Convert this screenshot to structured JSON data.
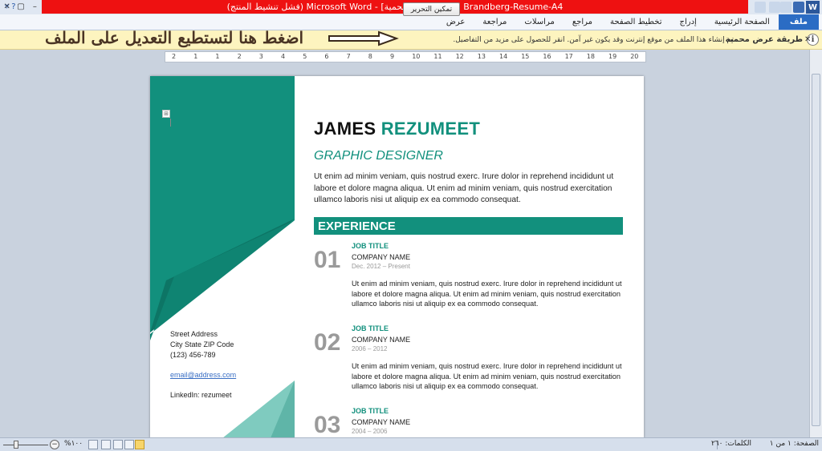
{
  "window": {
    "title": "Brandberg-Resume-A4 [طريقة عرض محمية] - Microsoft Word (فشل تنشيط المنتج)"
  },
  "ribbon": {
    "tabs": [
      "ملف",
      "الصفحة الرئيسية",
      "إدراج",
      "تخطيط الصفحة",
      "مراجع",
      "مراسلات",
      "مراجعة",
      "عرض"
    ]
  },
  "message_bar": {
    "title": "طريقة عرض محمية",
    "message": "تم إنشاء هذا الملف من موقع إنترنت وقد يكون غير آمن. انقر للحصول على مزيد من التفاصيل.",
    "enable_button": "تمكين التحرير",
    "annotation": "اضغط هنا لتستطيع التعديل على الملف"
  },
  "ruler": {
    "numbers": [
      "2",
      "1",
      "1",
      "2",
      "3",
      "4",
      "5",
      "6",
      "7",
      "8",
      "9",
      "10",
      "11",
      "12",
      "13",
      "14",
      "15",
      "16",
      "17",
      "18",
      "19",
      "20"
    ]
  },
  "resume": {
    "first_name": "JAMES",
    "last_name": "REZUMEET",
    "role": "GRAPHIC DESIGNER",
    "summary": "Ut enim ad minim veniam, quis nostrud exerc. Irure dolor in reprehend incididunt ut labore et dolore magna aliqua. Ut enim ad minim veniam, quis nostrud exercitation ullamco laboris nisi ut aliquip ex ea commodo consequat.",
    "contact": {
      "street": "Street Address",
      "city": "City State ZIP Code",
      "phone": "(123) 456-789",
      "email": "email@address.com",
      "linkedin": "LinkedIn:  rezumeet"
    },
    "experience_heading": "EXPERIENCE",
    "jobs": [
      {
        "num": "01",
        "title": "JOB TITLE",
        "company": "COMPANY NAME",
        "dates": "Dec. 2012 – Present",
        "desc": "Ut enim ad minim veniam, quis nostrud exerc. Irure dolor in reprehend incididunt ut labore et dolore magna aliqua. Ut enim ad minim veniam, quis nostrud exercitation ullamco laboris nisi ut aliquip ex ea commodo consequat."
      },
      {
        "num": "02",
        "title": "JOB TITLE",
        "company": "COMPANY NAME",
        "dates": "2006 – 2012",
        "desc": "Ut enim ad minim veniam, quis nostrud exerc. Irure dolor in reprehend incididunt ut labore et dolore magna aliqua. Ut enim ad minim veniam, quis nostrud exercitation ullamco laboris nisi ut aliquip ex ea commodo consequat."
      },
      {
        "num": "03",
        "title": "JOB TITLE",
        "company": "COMPANY NAME",
        "dates": "2004 – 2006",
        "desc": ""
      }
    ]
  },
  "status_bar": {
    "page": "الصفحة: ١ من ١",
    "words": "الكلمات: ٢٦٠",
    "zoom": "%١٠٠"
  },
  "colors": {
    "accent": "#12907d",
    "title_bar_red": "#ee1111",
    "message_bar": "#fdf4bf"
  }
}
